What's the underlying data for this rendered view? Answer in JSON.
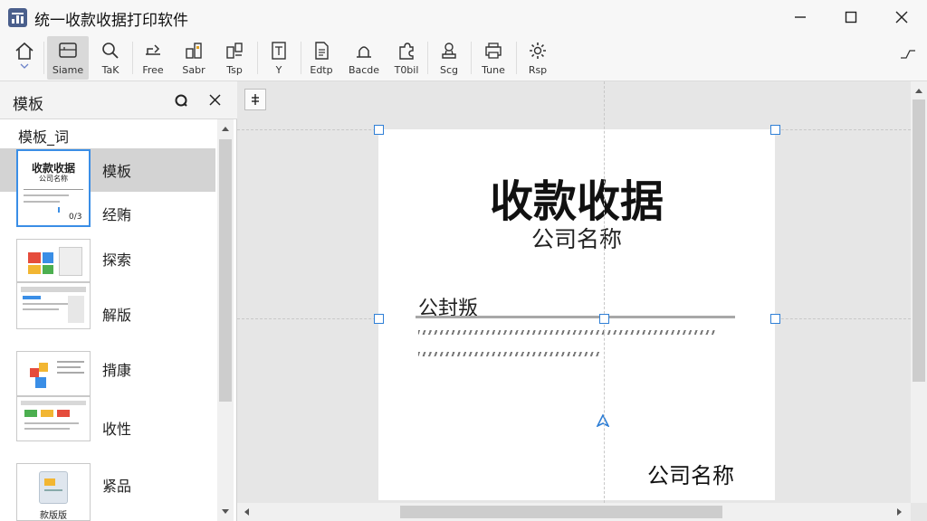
{
  "window": {
    "title": "统一收款收据打印软件"
  },
  "toolbar": {
    "items": [
      {
        "label": "",
        "icon": "home-icon"
      },
      {
        "label": "Siame",
        "icon": "frame-icon"
      },
      {
        "label": "TaK",
        "icon": "search-icon"
      },
      {
        "label": "Free",
        "icon": "free-icon"
      },
      {
        "label": "Sabr",
        "icon": "table-icon"
      },
      {
        "label": "Tsp",
        "icon": "layout-icon"
      },
      {
        "label": "Y",
        "icon": "text-icon"
      },
      {
        "label": "Edtp",
        "icon": "document-icon"
      },
      {
        "label": "Bacde",
        "icon": "barcode-icon"
      },
      {
        "label": "T0bil",
        "icon": "puzzle-icon"
      },
      {
        "label": "Scg",
        "icon": "stamp-icon"
      },
      {
        "label": "Tune",
        "icon": "printer-icon"
      },
      {
        "label": "Rsp",
        "icon": "gear-icon"
      }
    ]
  },
  "panel": {
    "title": "模板",
    "group_title": "模板_词",
    "rows": [
      {
        "label": "模板"
      },
      {
        "label": "经贿"
      },
      {
        "label": "探索"
      },
      {
        "label": "解版"
      },
      {
        "label": "揹康"
      },
      {
        "label": "收性"
      },
      {
        "label": "紧品"
      }
    ],
    "thumb_first": {
      "title": "收款收据",
      "subtitle": "公司名称",
      "badge": "0/3"
    },
    "thumb_last_caption": "款版版"
  },
  "document": {
    "title": "收款收据",
    "company": "公司名称",
    "label": "公封叛",
    "footer": "公司名称"
  },
  "colors": {
    "accent": "#3a8ee6",
    "handle": "#2f7fd6",
    "app_icon": "#4a5f8c"
  }
}
